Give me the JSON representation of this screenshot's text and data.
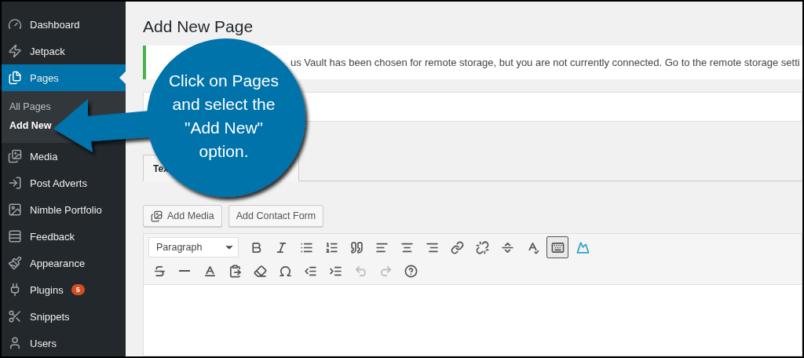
{
  "sidebar": {
    "items": [
      {
        "label": "Dashboard",
        "selected": false
      },
      {
        "label": "Jetpack",
        "selected": false
      },
      {
        "label": "Pages",
        "selected": true,
        "children": [
          {
            "label": "All Pages",
            "selected": false
          },
          {
            "label": "Add New",
            "selected": true
          }
        ]
      },
      {
        "label": "Media",
        "selected": false
      },
      {
        "label": "Post Adverts",
        "selected": false
      },
      {
        "label": "Nimble Portfolio",
        "selected": false
      },
      {
        "label": "Feedback",
        "selected": false
      },
      {
        "label": "Appearance",
        "selected": false
      },
      {
        "label": "Plugins",
        "selected": false,
        "badge": "5"
      },
      {
        "label": "Snippets",
        "selected": false
      },
      {
        "label": "Users",
        "selected": false
      }
    ]
  },
  "page": {
    "title": "Add New Page",
    "notice": "us Vault has been chosen for remote storage, but you are not currently connected. Go to the remote storage setti",
    "editor_tabs": [
      {
        "label": "Tex",
        "selected": true
      }
    ],
    "media_buttons": [
      "Add Media",
      "Add Contact Form"
    ],
    "format_select": "Paragraph",
    "toolbar_rows": [
      [
        {
          "kind": "bold",
          "pressed": false,
          "disabled": false
        },
        {
          "kind": "italic",
          "pressed": false,
          "disabled": false
        },
        {
          "kind": "bullets",
          "pressed": false,
          "disabled": false
        },
        {
          "kind": "numbers",
          "pressed": false,
          "disabled": false
        },
        {
          "kind": "quote",
          "pressed": false,
          "disabled": false
        },
        {
          "kind": "alignleft",
          "pressed": false,
          "disabled": false
        },
        {
          "kind": "aligncenter",
          "pressed": false,
          "disabled": false
        },
        {
          "kind": "alignright",
          "pressed": false,
          "disabled": false
        },
        {
          "kind": "link",
          "pressed": false,
          "disabled": false
        },
        {
          "kind": "unlink",
          "pressed": false,
          "disabled": false
        },
        {
          "kind": "more",
          "pressed": false,
          "disabled": false
        },
        {
          "kind": "spellcheck",
          "pressed": false,
          "disabled": false
        },
        {
          "kind": "toolbar",
          "pressed": true,
          "disabled": false
        },
        {
          "kind": "image",
          "pressed": false,
          "disabled": false
        }
      ],
      [
        {
          "kind": "strike",
          "pressed": false,
          "disabled": false
        },
        {
          "kind": "hr",
          "pressed": false,
          "disabled": false
        },
        {
          "kind": "color",
          "pressed": false,
          "disabled": false
        },
        {
          "kind": "paste",
          "pressed": false,
          "disabled": false
        },
        {
          "kind": "clear",
          "pressed": false,
          "disabled": false
        },
        {
          "kind": "omega",
          "pressed": false,
          "disabled": false
        },
        {
          "kind": "outdent",
          "pressed": false,
          "disabled": false
        },
        {
          "kind": "indent",
          "pressed": false,
          "disabled": false
        },
        {
          "kind": "undo",
          "pressed": false,
          "disabled": true
        },
        {
          "kind": "redo",
          "pressed": false,
          "disabled": true
        },
        {
          "kind": "help",
          "pressed": false,
          "disabled": false
        }
      ]
    ]
  },
  "annotation": {
    "text": "Click on Pages and select the \"Add New\" option."
  }
}
